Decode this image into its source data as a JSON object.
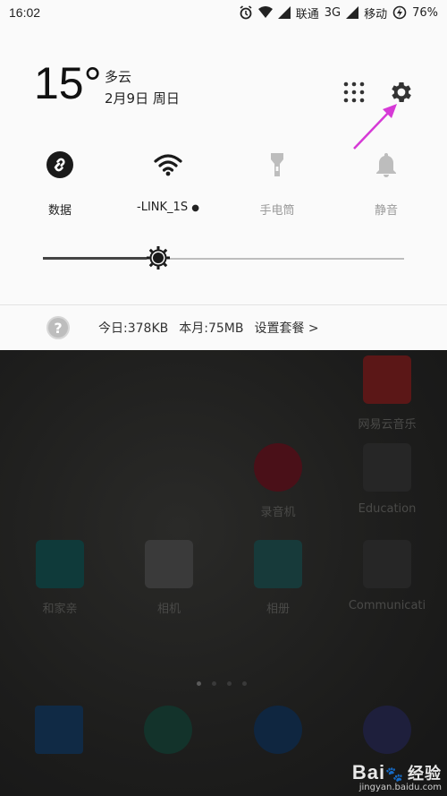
{
  "status_bar": {
    "time": "16:02",
    "carrier1": "联通",
    "network1": "3G",
    "carrier2": "移动",
    "battery": "76%"
  },
  "weather": {
    "temperature": "15°",
    "condition": "多云",
    "date": "2月9日 周日"
  },
  "quick_tiles": [
    {
      "label": "数据",
      "icon": "link-icon",
      "active": true
    },
    {
      "label": "-LINK_1S",
      "icon": "wifi-icon",
      "active": true
    },
    {
      "label": "手电筒",
      "icon": "flashlight-icon",
      "active": false
    },
    {
      "label": "静音",
      "icon": "bell-icon",
      "active": false
    }
  ],
  "brightness": {
    "level": 0.32
  },
  "data_usage": {
    "today": "今日:378KB",
    "month": "本月:75MB",
    "set_plan": "设置套餐 >"
  },
  "home_apps": [
    {
      "label": "网易云音乐",
      "color": "#5b1717"
    },
    {
      "label": "录音机",
      "color": "#4a1018"
    },
    {
      "label": "Education",
      "color": "#262626"
    },
    {
      "label": "和家亲",
      "color": "#0f3a3a"
    },
    {
      "label": "相机",
      "color": "#3a3a3a"
    },
    {
      "label": "相册",
      "color": "#173a3a"
    },
    {
      "label": "Communicati",
      "color": "#262626"
    }
  ],
  "watermark": {
    "brand": "Bai",
    "brand_suffix": "经验",
    "url": "jingyan.baidu.com"
  },
  "colors": {
    "panel_bg": "#fafafa",
    "annotation_arrow": "#d63ad6"
  }
}
